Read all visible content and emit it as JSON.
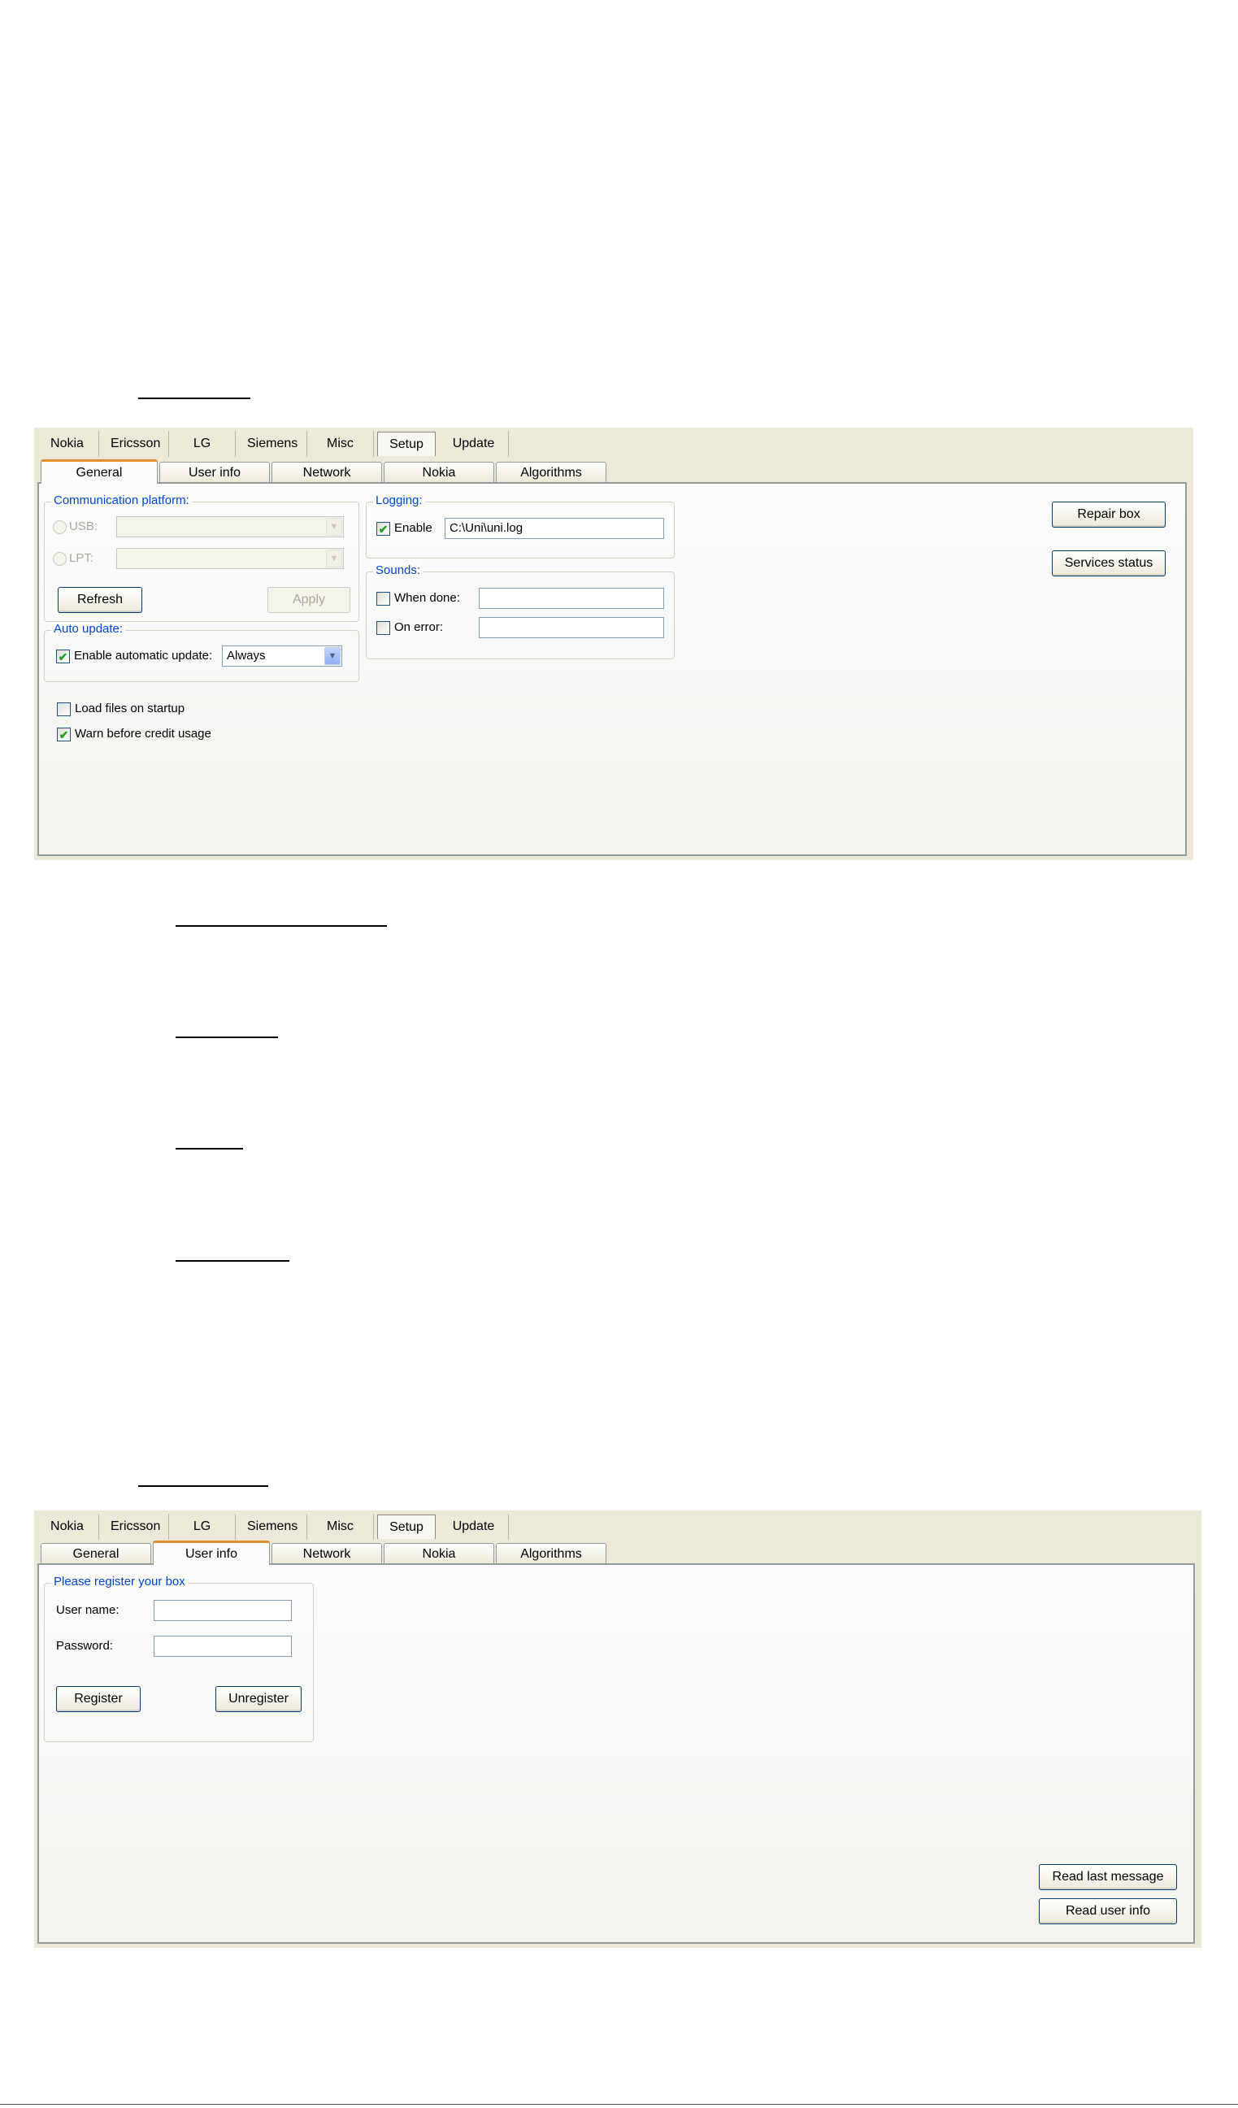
{
  "screen1": {
    "top_tabs": [
      "Nokia",
      "Ericsson",
      "LG",
      "Siemens",
      "Misc",
      "Setup",
      "Update"
    ],
    "sub_tabs": [
      "General",
      "User info",
      "Network",
      "Nokia",
      "Algorithms"
    ],
    "comm_platform": {
      "title": "Communication platform:",
      "usb_label": "USB:",
      "lpt_label": "LPT:",
      "refresh_label": "Refresh",
      "apply_label": "Apply"
    },
    "auto_update": {
      "title": "Auto update:",
      "enable_label": "Enable automatic update:",
      "enable_checked": true,
      "mode_value": "Always"
    },
    "load_files_label": "Load files on startup",
    "load_files_checked": false,
    "warn_label": "Warn before credit usage",
    "warn_checked": true,
    "logging": {
      "title": "Logging:",
      "enable_label": "Enable",
      "enable_checked": true,
      "path_value": "C:\\Uni\\uni.log"
    },
    "sounds": {
      "title": "Sounds:",
      "when_done_label": "When done:",
      "on_error_label": "On error:"
    },
    "repair_box_label": "Repair box",
    "services_status_label": "Services status"
  },
  "screen2": {
    "top_tabs": [
      "Nokia",
      "Ericsson",
      "LG",
      "Siemens",
      "Misc",
      "Setup",
      "Update"
    ],
    "sub_tabs": [
      "General",
      "User info",
      "Network",
      "Nokia",
      "Algorithms"
    ],
    "register": {
      "title": "Please register your box",
      "username_label": "User name:",
      "password_label": "Password:",
      "register_label": "Register",
      "unregister_label": "Unregister"
    },
    "read_last_message_label": "Read last message",
    "read_user_info_label": "Read user info"
  }
}
